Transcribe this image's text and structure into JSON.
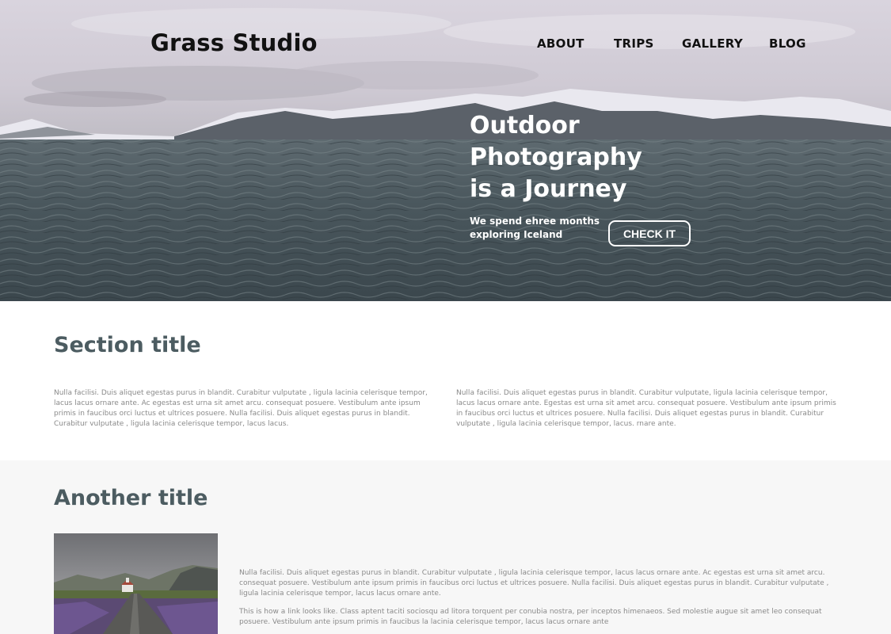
{
  "header": {
    "brand": "Grass Studio",
    "nav": [
      {
        "label": "ABOUT"
      },
      {
        "label": "TRIPS"
      },
      {
        "label": "GALLERY"
      },
      {
        "label": "BLOG"
      }
    ]
  },
  "hero": {
    "title_lines": [
      "Outdoor",
      "Photography",
      "is a Journey"
    ],
    "subtitle_lines": [
      "We spend ehree months",
      "exploring Iceland"
    ],
    "cta_label": "CHECK IT"
  },
  "section1": {
    "title": "Section title",
    "col1": "Nulla facilisi. Duis aliquet egestas purus in blandit. Curabitur vulputate , ligula lacinia celerisque tempor, lacus lacus ornare ante. Ac egestas est urna sit amet arcu. consequat posuere. Vestibulum ante ipsum primis in faucibus orci luctus et ultrices posuere. Nulla facilisi. Duis aliquet egestas purus in blandit. Curabitur vulputate , ligula lacinia celerisque tempor, lacus lacus.",
    "col2": "Nulla facilisi. Duis aliquet egestas purus in blandit. Curabitur vulputate, ligula lacinia celerisque tempor, lacus lacus ornare ante. Egestas est urna sit amet arcu. consequat posuere. Vestibulum ante ipsum primis in faucibus orci luctus et ultrices posuere. Nulla facilisi. Duis aliquet egestas purus in blandit. Curabitur vulputate , ligula lacinia celerisque tempor, lacus. rnare ante."
  },
  "section2": {
    "title": "Another title",
    "para1": "Nulla facilisi. Duis aliquet egestas purus in blandit. Curabitur vulputate , ligula lacinia celerisque tempor, lacus lacus ornare ante. Ac egestas est urna sit amet arcu. consequat posuere. Vestibulum ante ipsum primis in faucibus orci luctus et ultrices posuere. Nulla facilisi. Duis aliquet egestas purus in blandit. Curabitur vulputate , ligula lacinia celerisque tempor, lacus lacus ornare ante.",
    "para2": "This is how a link looks like. Class aptent taciti sociosqu ad litora torquent per conubia nostra, per inceptos himenaeos. Sed molestie augue sit amet leo consequat posuere. Vestibulum ante ipsum primis in faucibus la lacinia celerisque tempor, lacus lacus ornare ante"
  }
}
